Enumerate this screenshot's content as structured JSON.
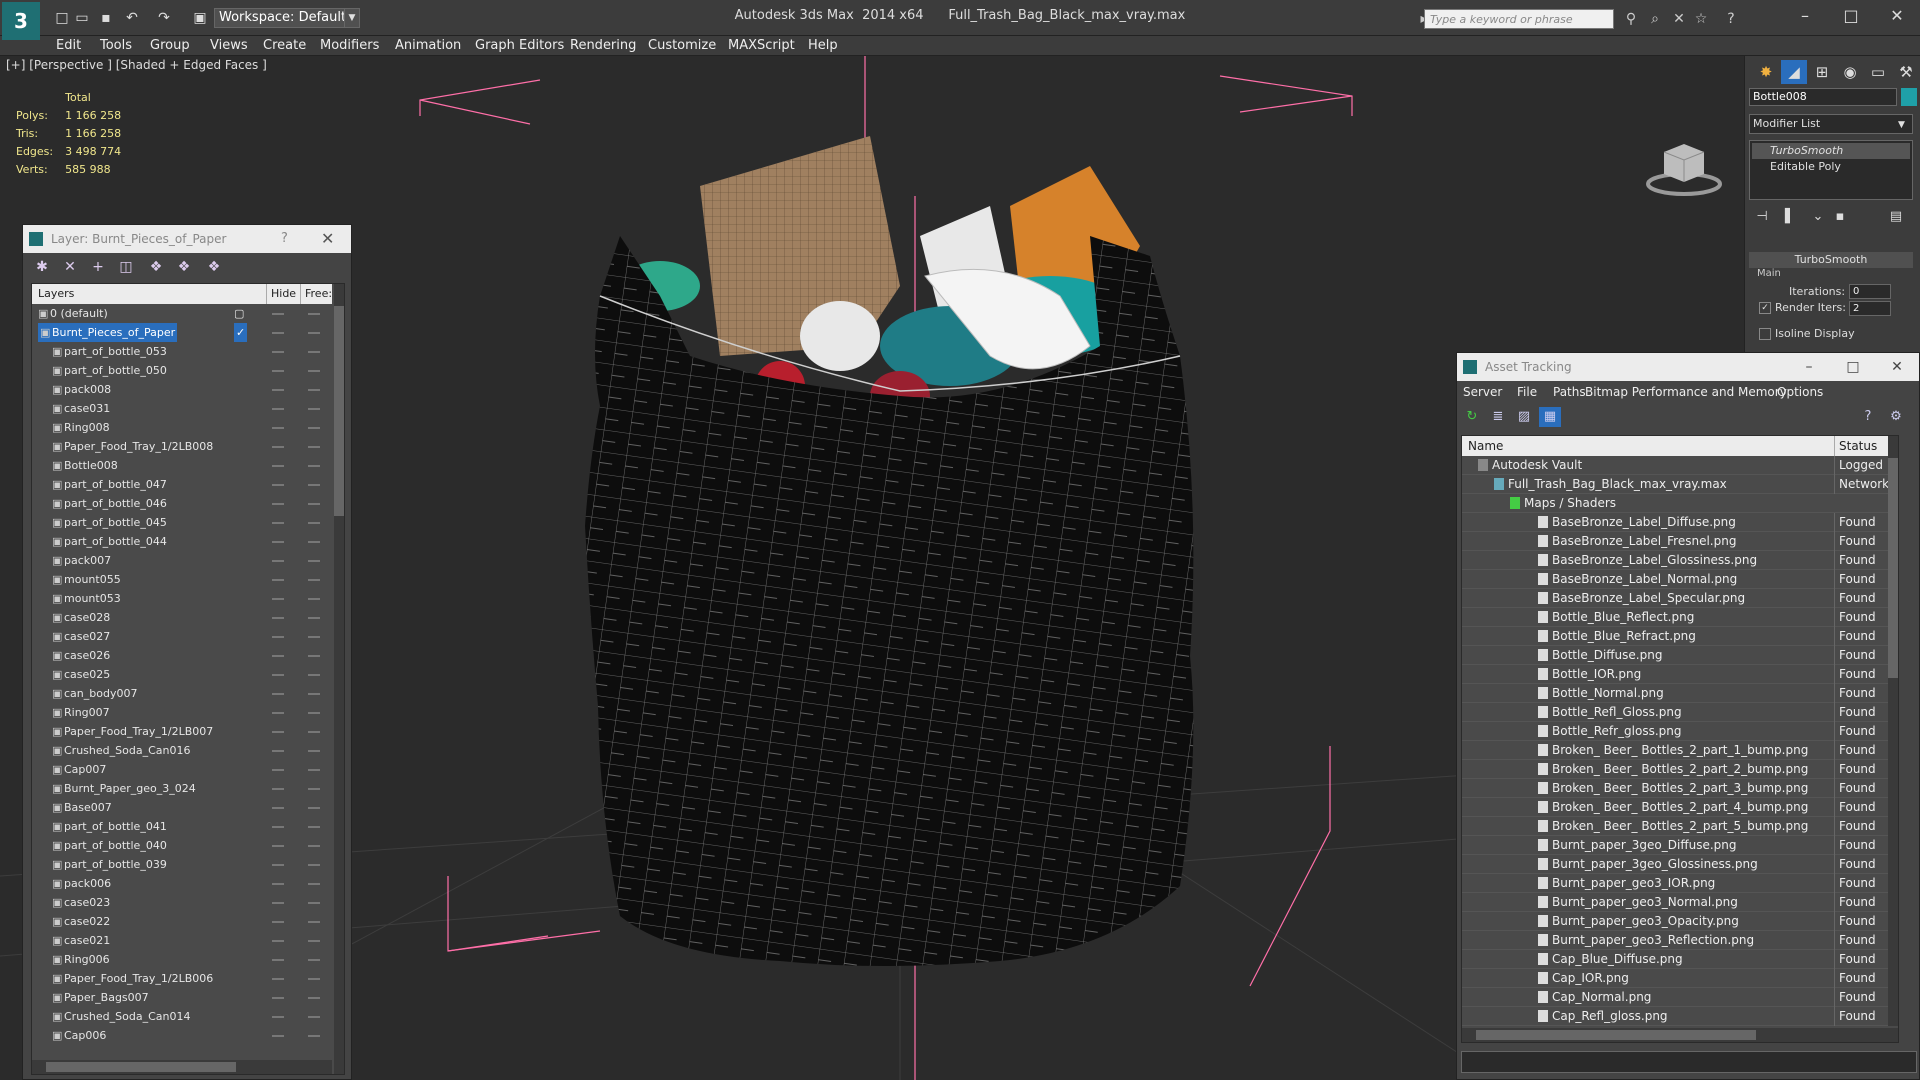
{
  "titlebar": {
    "logo": "3",
    "workspace": "Workspace: Default",
    "app": "Autodesk 3ds Max  2014 x64",
    "file": "Full_Trash_Bag_Black_max_vray.max",
    "search_placeholder": "Type a keyword or phrase"
  },
  "menu": [
    "Edit",
    "Tools",
    "Group",
    "Views",
    "Create",
    "Modifiers",
    "Animation",
    "Graph Editors",
    "Rendering",
    "Customize",
    "MAXScript",
    "Help"
  ],
  "viewport": {
    "label": "[+] [Perspective ] [Shaded + Edged Faces ]",
    "stats": {
      "header": "Total",
      "rows": [
        {
          "k": "Polys:",
          "v": "1 166 258"
        },
        {
          "k": "Tris:",
          "v": "1 166 258"
        },
        {
          "k": "Edges:",
          "v": "3 498 774"
        },
        {
          "k": "Verts:",
          "v": "585 988"
        }
      ]
    }
  },
  "layer_panel": {
    "title": "Layer: Burnt_Pieces_of_Paper",
    "help": "?",
    "col_layers": "Layers",
    "col_hide": "Hide",
    "col_freeze": "Free:",
    "default_layer": "0 (default)",
    "selected_layer": "Burnt_Pieces_of_Paper",
    "items": [
      "part_of_bottle_053",
      "part_of_bottle_050",
      "pack008",
      "case031",
      "Ring008",
      "Paper_Food_Tray_1/2LB008",
      "Bottle008",
      "part_of_bottle_047",
      "part_of_bottle_046",
      "part_of_bottle_045",
      "part_of_bottle_044",
      "pack007",
      "mount055",
      "mount053",
      "case028",
      "case027",
      "case026",
      "case025",
      "can_body007",
      "Ring007",
      "Paper_Food_Tray_1/2LB007",
      "Crushed_Soda_Can016",
      "Cap007",
      "Burnt_Paper_geo_3_024",
      "Base007",
      "part_of_bottle_041",
      "part_of_bottle_040",
      "part_of_bottle_039",
      "pack006",
      "case023",
      "case022",
      "case021",
      "Ring006",
      "Paper_Food_Tray_1/2LB006",
      "Paper_Bags007",
      "Crushed_Soda_Can014",
      "Cap006"
    ]
  },
  "command_panel": {
    "object_name": "Bottle008",
    "object_color": "#1fa0a8",
    "modifier_list": "Modifier List",
    "stack": [
      "TurboSmooth",
      "Editable Poly"
    ],
    "rollout": "TurboSmooth",
    "group": "Main",
    "iterations_label": "Iterations:",
    "iterations": "0",
    "render_iters_label": "Render Iters:",
    "render_iters": "2",
    "isoline": "Isoline Display"
  },
  "asset_tracking": {
    "title": "Asset Tracking",
    "menu": [
      "Server",
      "File",
      "Paths",
      "Bitmap Performance and Memory",
      "Options"
    ],
    "col_name": "Name",
    "col_status": "Status",
    "vault": {
      "name": "Autodesk Vault",
      "status": "Logged"
    },
    "file": {
      "name": "Full_Trash_Bag_Black_max_vray.max",
      "status": "Network"
    },
    "group": "Maps / Shaders",
    "found": "Found",
    "maps": [
      "BaseBronze_Label_Diffuse.png",
      "BaseBronze_Label_Fresnel.png",
      "BaseBronze_Label_Glossiness.png",
      "BaseBronze_Label_Normal.png",
      "BaseBronze_Label_Specular.png",
      "Bottle_Blue_Reflect.png",
      "Bottle_Blue_Refract.png",
      "Bottle_Diffuse.png",
      "Bottle_IOR.png",
      "Bottle_Normal.png",
      "Bottle_Refl_Gloss.png",
      "Bottle_Refr_gloss.png",
      "Broken_ Beer_ Bottles_2_part_1_bump.png",
      "Broken_ Beer_ Bottles_2_part_2_bump.png",
      "Broken_ Beer_ Bottles_2_part_3_bump.png",
      "Broken_ Beer_ Bottles_2_part_4_bump.png",
      "Broken_ Beer_ Bottles_2_part_5_bump.png",
      "Burnt_paper_3geo_Diffuse.png",
      "Burnt_paper_3geo_Glossiness.png",
      "Burnt_paper_geo3_IOR.png",
      "Burnt_paper_geo3_Normal.png",
      "Burnt_paper_geo3_Opacity.png",
      "Burnt_paper_geo3_Reflection.png",
      "Cap_Blue_Diffuse.png",
      "Cap_IOR.png",
      "Cap_Normal.png",
      "Cap_Refl_gloss.png"
    ]
  }
}
